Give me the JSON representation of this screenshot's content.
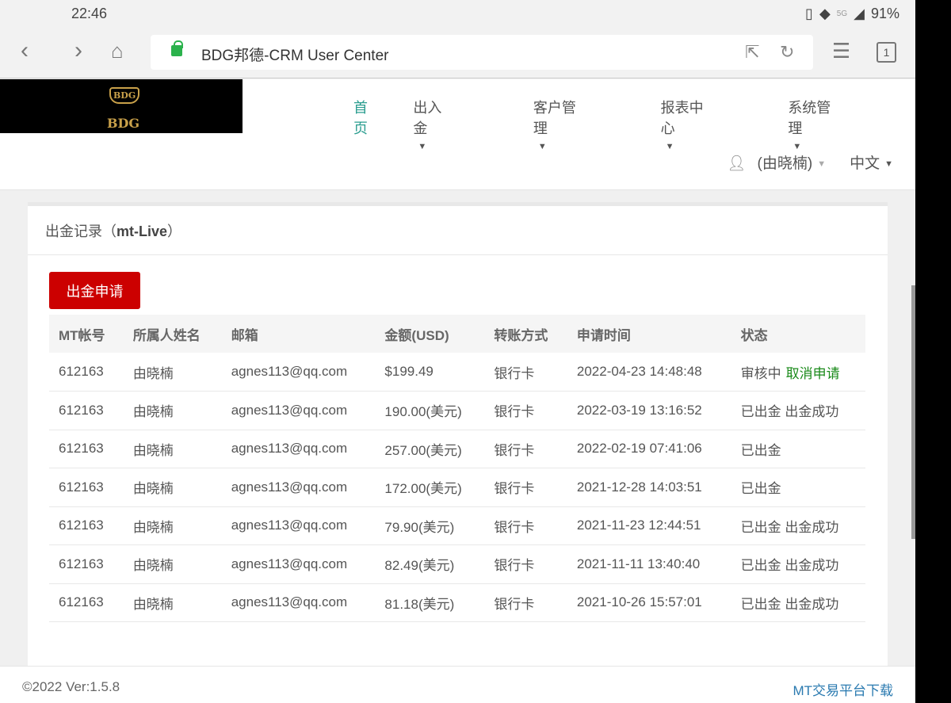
{
  "status": {
    "time": "22:46",
    "network": "5G",
    "battery": "91%"
  },
  "browser": {
    "title": "BDG邦德-CRM User Center",
    "tabs_count": "1"
  },
  "logo": {
    "text": "BDG"
  },
  "nav": {
    "items": [
      {
        "label": "首页"
      },
      {
        "label": "出入金"
      },
      {
        "label": "客户管理"
      },
      {
        "label": "报表中心"
      },
      {
        "label": "系统管理"
      }
    ]
  },
  "user": {
    "name": "(由晓楠)",
    "language": "中文"
  },
  "panel": {
    "title": "出金记录（",
    "title_bold": "mt-Live",
    "title_end": "）",
    "apply_button": "出金申请"
  },
  "table": {
    "headers": [
      "MT帐号",
      "所属人姓名",
      "邮箱",
      "金额(USD)",
      "转账方式",
      "申请时间",
      "状态"
    ],
    "rows": [
      [
        "612163",
        "由晓楠",
        "agnes113@qq.com",
        "$199.49",
        "银行卡",
        "2022-04-23 14:48:48",
        "审核中",
        "取消申请"
      ],
      [
        "612163",
        "由晓楠",
        "agnes113@qq.com",
        "190.00(美元)",
        "银行卡",
        "2022-03-19 13:16:52",
        "已出金 出金成功",
        ""
      ],
      [
        "612163",
        "由晓楠",
        "agnes113@qq.com",
        "257.00(美元)",
        "银行卡",
        "2022-02-19 07:41:06",
        "已出金",
        ""
      ],
      [
        "612163",
        "由晓楠",
        "agnes113@qq.com",
        "172.00(美元)",
        "银行卡",
        "2021-12-28 14:03:51",
        "已出金",
        ""
      ],
      [
        "612163",
        "由晓楠",
        "agnes113@qq.com",
        "79.90(美元)",
        "银行卡",
        "2021-11-23 12:44:51",
        "已出金 出金成功",
        ""
      ],
      [
        "612163",
        "由晓楠",
        "agnes113@qq.com",
        "82.49(美元)",
        "银行卡",
        "2021-11-11 13:40:40",
        "已出金 出金成功",
        ""
      ],
      [
        "612163",
        "由晓楠",
        "agnes113@qq.com",
        "81.18(美元)",
        "银行卡",
        "2021-10-26 15:57:01",
        "已出金 出金成功",
        ""
      ]
    ]
  },
  "footer": {
    "version": "©2022 Ver:1.5.8",
    "download": "MT交易平台下载"
  }
}
